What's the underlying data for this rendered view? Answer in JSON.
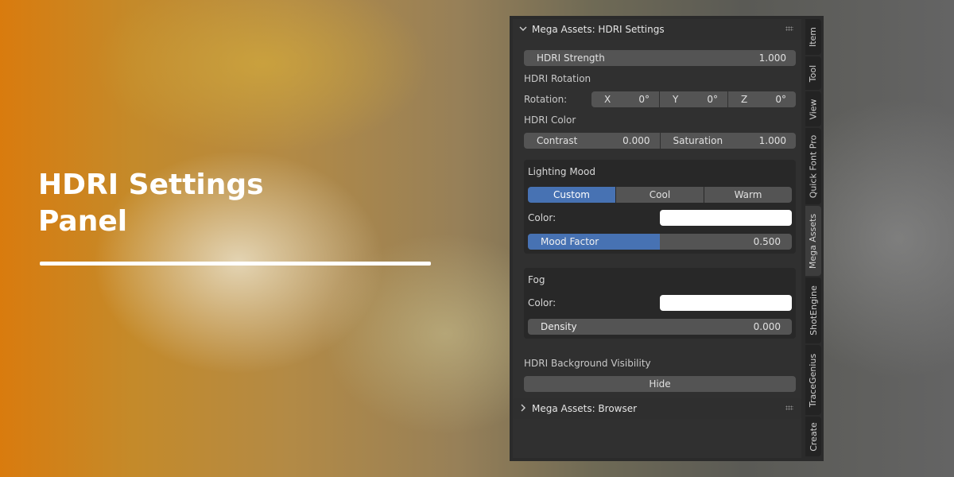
{
  "hero": {
    "title_line1": "HDRI Settings",
    "title_line2": "Panel"
  },
  "panel": {
    "hdri_settings_header": "Mega Assets: HDRI Settings",
    "hdri_strength": {
      "label": "HDRI Strength",
      "value": "1.000"
    },
    "rotation_section": "HDRI Rotation",
    "rotation": {
      "label": "Rotation:",
      "x": {
        "axis": "X",
        "value": "0°"
      },
      "y": {
        "axis": "Y",
        "value": "0°"
      },
      "z": {
        "axis": "Z",
        "value": "0°"
      }
    },
    "color_section": "HDRI Color",
    "contrast": {
      "label": "Contrast",
      "value": "0.000"
    },
    "saturation": {
      "label": "Saturation",
      "value": "1.000"
    },
    "lighting_mood": {
      "title": "Lighting Mood",
      "options": [
        "Custom",
        "Cool",
        "Warm"
      ],
      "selected": "Custom",
      "color_label": "Color:",
      "color_value": "#ffffff",
      "mood_factor": {
        "label": "Mood Factor",
        "value": "0.500",
        "fraction": 0.5
      }
    },
    "fog": {
      "title": "Fog",
      "color_label": "Color:",
      "color_value": "#ffffff",
      "density": {
        "label": "Density",
        "value": "0.000",
        "fraction": 0.0
      }
    },
    "background_visibility": {
      "label": "HDRI Background Visibility",
      "button": "Hide"
    },
    "browser_header": "Mega Assets: Browser",
    "accent_color": "#4772b3"
  },
  "tabs": [
    "Item",
    "Tool",
    "View",
    "Quick Font Pro",
    "Mega Assets",
    "ShotEngine",
    "TraceGenius",
    "Create"
  ],
  "active_tab": "Mega Assets"
}
